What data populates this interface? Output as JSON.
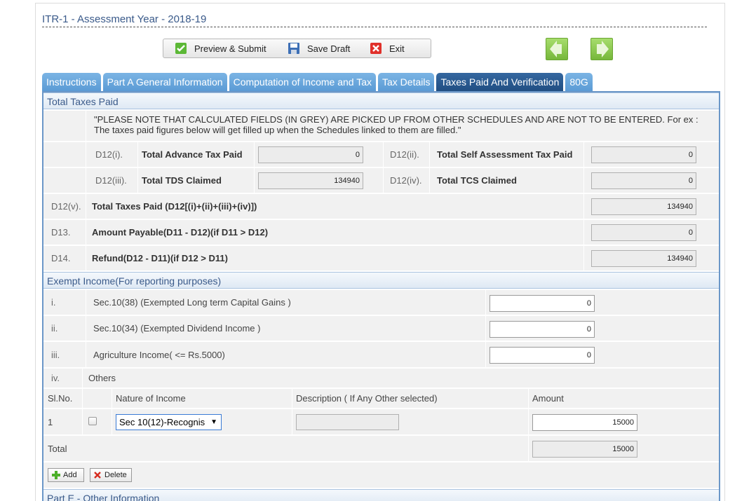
{
  "page_title": "ITR-1 - Assessment Year - 2018-19",
  "toolbar": {
    "preview_submit": "Preview & Submit",
    "save_draft": "Save Draft",
    "exit": "Exit"
  },
  "tabs": [
    {
      "label": "Instructions"
    },
    {
      "label": "Part A General Information"
    },
    {
      "label": "Computation of Income and Tax"
    },
    {
      "label": "Tax Details"
    },
    {
      "label": "Taxes Paid And Verification"
    },
    {
      "label": "80G"
    }
  ],
  "taxes_paid": {
    "heading": "Total Taxes Paid",
    "note": "\"PLEASE NOTE THAT CALCULATED FIELDS (IN GREY) ARE PICKED UP FROM OTHER SCHEDULES AND ARE NOT TO BE ENTERED. For ex : The taxes paid figures below will get filled up when the Schedules linked to them are filled.\"",
    "d12i": {
      "code": "D12(i).",
      "label": "Total Advance Tax Paid",
      "value": "0"
    },
    "d12ii": {
      "code": "D12(ii).",
      "label": "Total Self Assessment Tax Paid",
      "value": "0"
    },
    "d12iii": {
      "code": "D12(iii).",
      "label": "Total TDS Claimed",
      "value": "134940"
    },
    "d12iv": {
      "code": "D12(iv).",
      "label": "Total TCS Claimed",
      "value": "0"
    },
    "d12v": {
      "code": "D12(v).",
      "label": "Total Taxes Paid (D12[(i)+(ii)+(iii)+(iv)])",
      "value": "134940"
    },
    "d13": {
      "code": "D13.",
      "label": "Amount Payable(D11 - D12)(if D11 > D12)",
      "value": "0"
    },
    "d14": {
      "code": "D14.",
      "label": "Refund(D12 - D11)(if D12 > D11)",
      "value": "134940"
    }
  },
  "exempt_income": {
    "heading": "Exempt Income(For reporting purposes)",
    "items": [
      {
        "code": "i.",
        "label": "Sec.10(38) (Exempted Long term Capital Gains )",
        "value": "0"
      },
      {
        "code": "ii.",
        "label": "Sec.10(34) (Exempted Dividend Income )",
        "value": "0"
      },
      {
        "code": "iii.",
        "label": "Agriculture Income( <= Rs.5000)",
        "value": "0"
      }
    ],
    "others_code": "iv.",
    "others_label": "Others",
    "table_headers": {
      "slno": "Sl.No.",
      "nature": "Nature of Income",
      "description": "Description ( If Any Other selected)",
      "amount": "Amount"
    },
    "rows": [
      {
        "slno": "1",
        "nature": "Sec 10(12)-Recognis",
        "description": "",
        "amount": "15000"
      }
    ],
    "total_label": "Total",
    "total_value": "15000",
    "add_button": "Add",
    "delete_button": "Delete"
  },
  "part_e_heading": "Part E - Other Information",
  "colors": {
    "tab": "#5b9bd5",
    "tab_active": "#204e82",
    "nav_arrow": "#8cc63f",
    "heading_text": "#3a5a8a"
  }
}
